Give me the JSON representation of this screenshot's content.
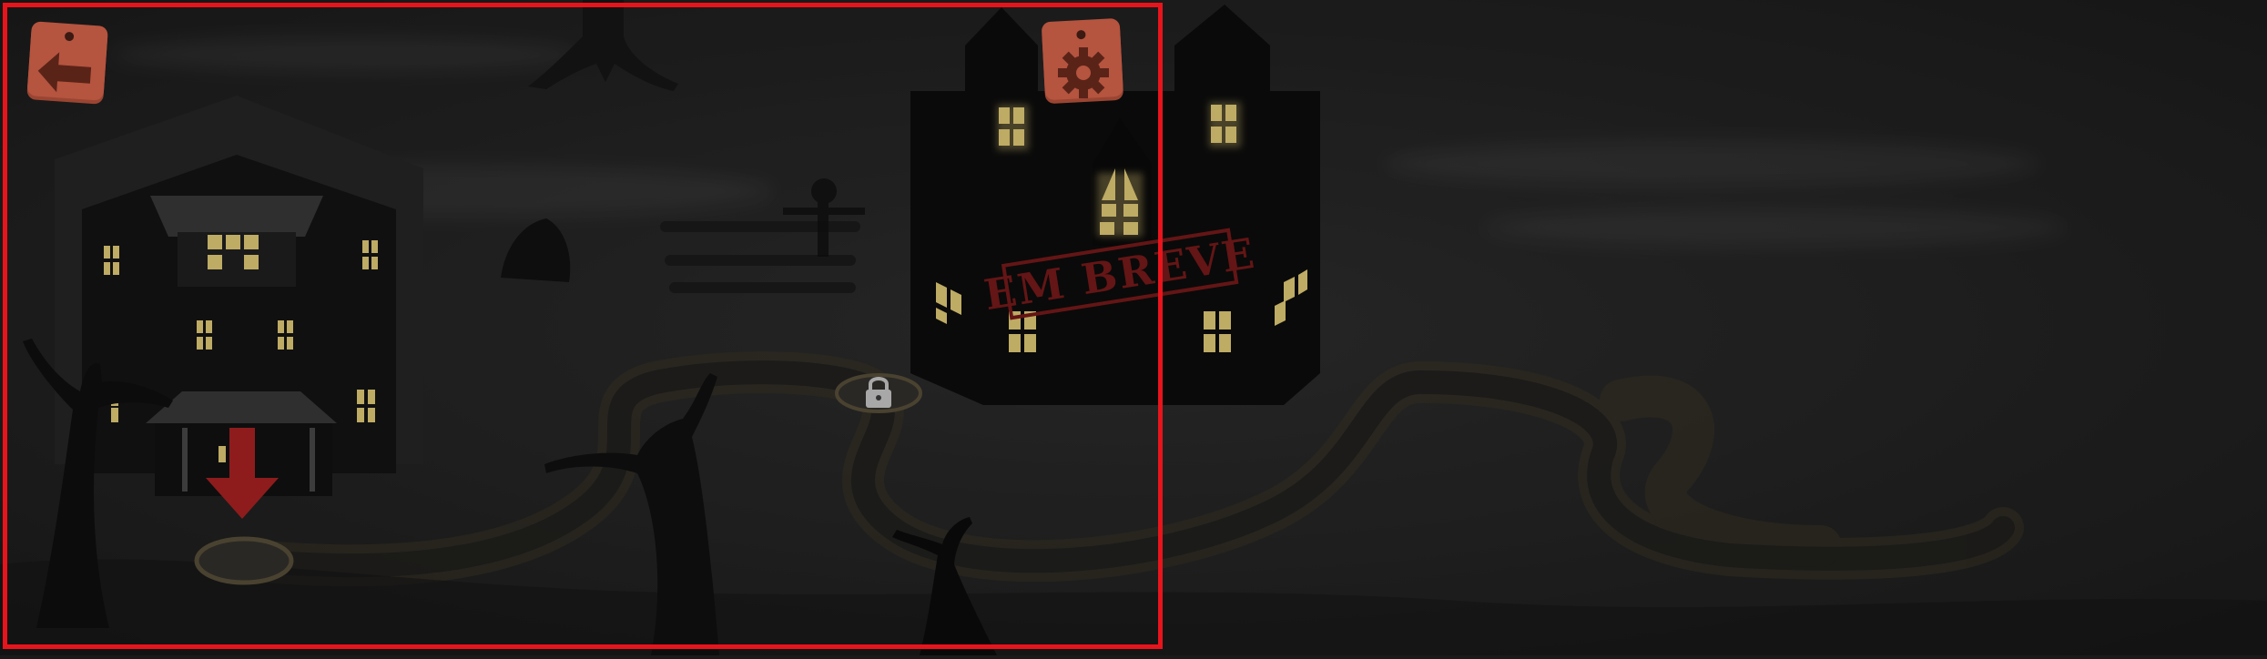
{
  "game": {
    "stamp_text": "EM BREVE"
  },
  "buttons": {
    "back_icon": "arrow-left-icon",
    "settings_icon": "gear-icon"
  },
  "map": {
    "level_marker_icon": "down-arrow-icon",
    "locked_level_icon": "lock-icon"
  },
  "colors": {
    "button_face": "#b5543f",
    "window_light": "#e8d17a",
    "stamp_red": "#7a1a1a",
    "arrow_red": "#8e1c1c",
    "fog": "#2a2a2a",
    "frame_red": "#e8141c"
  }
}
